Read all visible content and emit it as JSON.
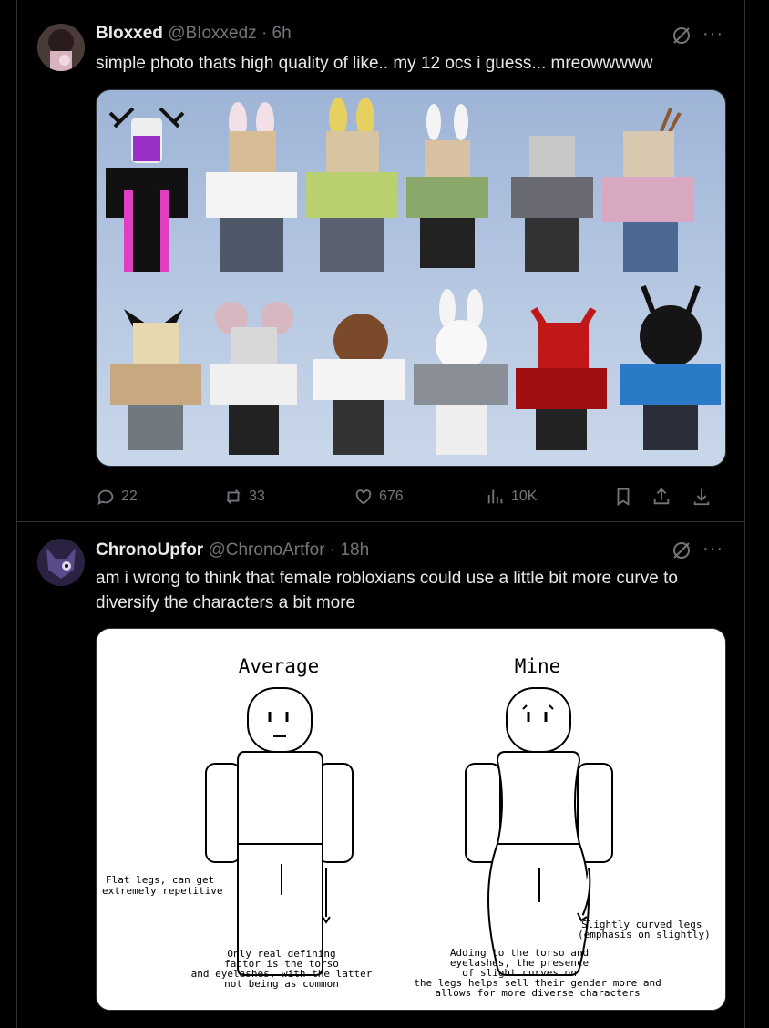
{
  "posts": [
    {
      "name": "Bloxxed",
      "handle": "@BIoxxedz",
      "sep": "·",
      "time": "6h",
      "text": "simple photo thats high quality of like.. my 12 ocs i guess... mreowwwww",
      "stats": {
        "replies": "22",
        "reposts": "33",
        "likes": "676",
        "views": "10K"
      }
    },
    {
      "name": "ChronoUpfor",
      "handle": "@ChronoArtfor",
      "sep": "·",
      "time": "18h",
      "text": "am i wrong to think that female robloxians could use a little bit more curve to diversify the characters a bit more",
      "drawing": {
        "left_title": "Average",
        "right_title": "Mine",
        "note_flat_1": "Flat legs, can get",
        "note_flat_2": "extremely repetitive",
        "note_only_1": "Only real defining",
        "note_only_2": "factor is the torso",
        "note_only_3": "and eyelashes, with the latter",
        "note_only_4": "not being as common",
        "note_curved_1": "Slightly curved legs",
        "note_curved_2": "(emphasis on slightly)",
        "note_add_1": "Adding to the torso and",
        "note_add_2": "eyelashes, the presence",
        "note_add_3": "of slight curves on",
        "note_add_4": "the legs helps sell their gender more and",
        "note_add_5": "allows for more diverse characters"
      }
    }
  ],
  "colors": {
    "background": "#000000",
    "border": "#2f3336",
    "muted": "#71767b",
    "text": "#e7e9ea"
  }
}
